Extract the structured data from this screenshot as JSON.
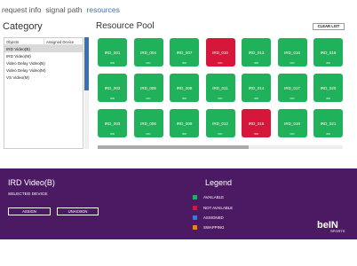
{
  "nav": {
    "items": [
      "request info",
      "signal path",
      "resources"
    ]
  },
  "category": {
    "title": "Category",
    "col_objects": "Objects",
    "col_assigned": "Assigned Device",
    "rows": [
      "IRD Video(B)",
      "IRD Video(M)",
      "Video Delay Video(B)",
      "Video Delay Video(M)",
      "VS Video(M)"
    ]
  },
  "pool": {
    "title": "Resource Pool",
    "clear_label": "CLEAR LIST",
    "tiles": [
      {
        "name": "IRD_001",
        "state": "IRD",
        "status": "available"
      },
      {
        "name": "IRD_004",
        "state": "IRD",
        "status": "available"
      },
      {
        "name": "IRD_007",
        "state": "IRD",
        "status": "available"
      },
      {
        "name": "IRD_010",
        "state": "IRD",
        "status": "not_available"
      },
      {
        "name": "IRD_013",
        "state": "IRD",
        "status": "available"
      },
      {
        "name": "IRD_016",
        "state": "IRD",
        "status": "available"
      },
      {
        "name": "IRD_019",
        "state": "IRD",
        "status": "available"
      },
      {
        "name": "IRD_002",
        "state": "IRD",
        "status": "available"
      },
      {
        "name": "IRD_005",
        "state": "IRD",
        "status": "available"
      },
      {
        "name": "IRD_008",
        "state": "IRD",
        "status": "available"
      },
      {
        "name": "IRD_011",
        "state": "IRD",
        "status": "available"
      },
      {
        "name": "IRD_014",
        "state": "IRD",
        "status": "available"
      },
      {
        "name": "IRD_017",
        "state": "IRD",
        "status": "available"
      },
      {
        "name": "IRD_020",
        "state": "IRD",
        "status": "available"
      },
      {
        "name": "IRD_003",
        "state": "IRD",
        "status": "available"
      },
      {
        "name": "IRD_006",
        "state": "IRD",
        "status": "available"
      },
      {
        "name": "IRD_009",
        "state": "IRD",
        "status": "available"
      },
      {
        "name": "IRD_012",
        "state": "IRD",
        "status": "available"
      },
      {
        "name": "IRD_015",
        "state": "IRD",
        "status": "not_available"
      },
      {
        "name": "IRD_018",
        "state": "IRD",
        "status": "available"
      },
      {
        "name": "IRD_021",
        "state": "IRD",
        "status": "available"
      }
    ]
  },
  "device": {
    "title": "IRD Video(B)",
    "selected_label": "SELECTED DEVICE",
    "assign_label": "ASSIGN",
    "unassign_label": "UNASSIGN"
  },
  "legend": {
    "title": "Legend",
    "items": [
      {
        "label": "AVAILABLE",
        "color": "#1fb25a"
      },
      {
        "label": "NOT AVAILABLE",
        "color": "#d7163b"
      },
      {
        "label": "ASSIGNED",
        "color": "#2b7fd6"
      },
      {
        "label": "SWAPPING",
        "color": "#ef7d1e"
      }
    ]
  },
  "logo": {
    "brand": "beIN",
    "sub": "SPORTS"
  },
  "colors": {
    "available": "#1fb25a",
    "not_available": "#d7163b",
    "panel": "#4c1a63",
    "accent": "#3d6fb6"
  }
}
